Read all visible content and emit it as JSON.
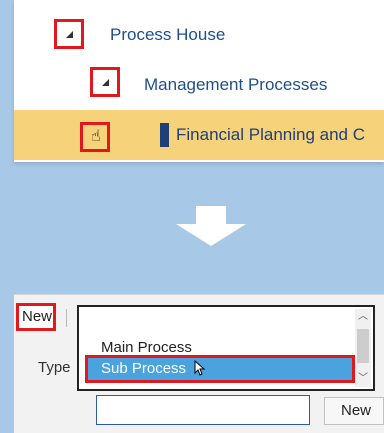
{
  "tree": {
    "items": [
      {
        "label": "Process House"
      },
      {
        "label": "Management Processes"
      },
      {
        "label": "Financial Planning and C"
      }
    ]
  },
  "dialog": {
    "new_label": "New",
    "type_label": "Type",
    "dropdown": {
      "options": [
        "Main Process",
        "Sub Process"
      ],
      "selected": "Sub Process"
    },
    "input_value": "",
    "new_button_label": "New"
  },
  "icons": {
    "expand": "collapse-triangle-icon",
    "hand": "hand-pointer-icon",
    "arrow": "down-arrow-icon",
    "pointer": "mouse-pointer-icon"
  },
  "colors": {
    "background": "#a8c8e8",
    "highlight_row": "#f6d37a",
    "tree_text": "#1f4e8c",
    "annotation_red": "#e0191e",
    "selected_option": "#4aa3df",
    "input_border": "#2a5db0"
  }
}
